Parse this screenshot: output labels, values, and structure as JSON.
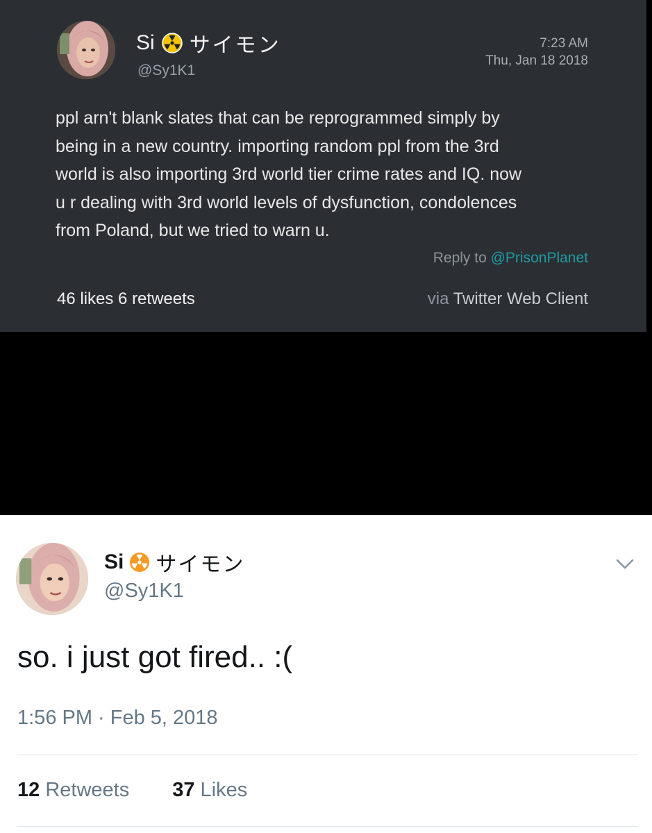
{
  "tweet_old": {
    "display_name": "Si",
    "name_suffix": "サイモン",
    "handle": "@Sy1K1",
    "time": "7:23 AM",
    "date": "Thu, Jan 18 2018",
    "text_lines": [
      "ppl arn't blank slates that can be reprogrammed simply by",
      "being in a new country.  importing random ppl from the 3rd",
      "world is also importing 3rd world tier crime rates and IQ. now",
      "u r dealing with 3rd world levels of dysfunction, condolences",
      "from Poland, but we tried to warn u."
    ],
    "reply_prefix": "Reply to",
    "reply_mention": "@PrisonPlanet",
    "likes_label": "46 likes",
    "retweets_label": "6 retweets",
    "via_word": "via",
    "client": "Twitter Web Client",
    "emoji_icon": "radioactive-icon"
  },
  "tweet_new": {
    "display_name": "Si",
    "name_suffix": "サイモン",
    "handle": "@Sy1K1",
    "text": "so. i just got fired.. :(",
    "timestamp": "1:56 PM · Feb 5, 2018",
    "retweets_count": "12",
    "retweets_label": "Retweets",
    "likes_count": "37",
    "likes_label": "Likes",
    "emoji_icon": "radioactive-icon",
    "menu_icon": "chevron-down-icon"
  },
  "colors": {
    "dark_card_bg": "#2b2f33",
    "mention_teal": "#1f9aa3",
    "radioactive_yellow": "#f5c400",
    "radioactive_orange": "#f59a23",
    "secondary_gray": "#657786"
  }
}
